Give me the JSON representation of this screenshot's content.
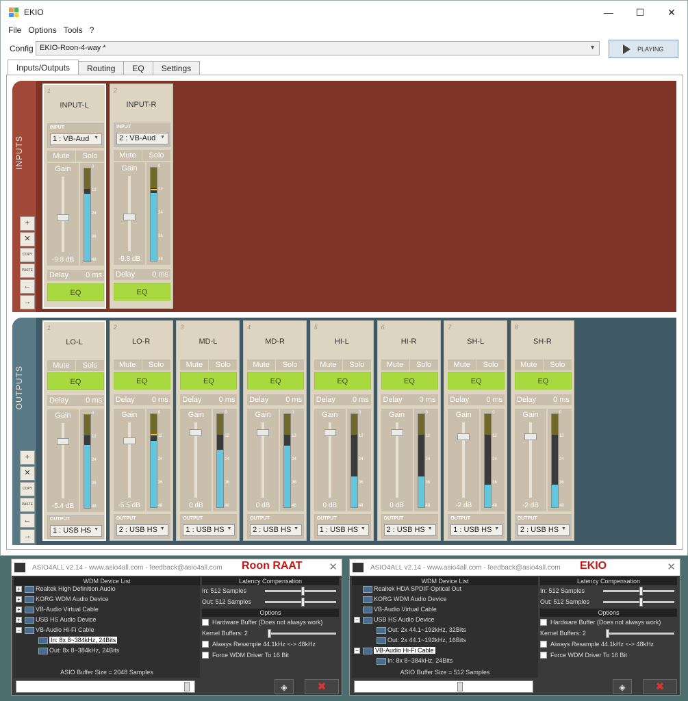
{
  "window": {
    "title": "EKIO",
    "min": "—",
    "max": "☐",
    "close": "✕"
  },
  "menu": [
    "File",
    "Options",
    "Tools",
    "?"
  ],
  "config": {
    "label": "Config",
    "value": "EKIO-Roon-4-way *",
    "play_label": "PLAYING"
  },
  "tabs": [
    "Inputs/Outputs",
    "Routing",
    "EQ",
    "Settings"
  ],
  "inputs_label": "INPUTS",
  "outputs_label": "OUTPUTS",
  "side_buttons": [
    "+",
    "✕",
    "COPY",
    "PASTE",
    "←",
    "→"
  ],
  "common": {
    "mute": "Mute",
    "solo": "Solo",
    "eq": "EQ",
    "delay": "Delay",
    "gain": "Gain",
    "input_lbl": "INPUT",
    "output_lbl": "OUTPUT"
  },
  "scale": [
    "0",
    "12",
    "24",
    "36",
    "48"
  ],
  "inputs": [
    {
      "num": "1",
      "name": "INPUT-L",
      "device": "1 : VB-Aud",
      "delay": "0 ms",
      "gain": "-9.8 dB",
      "gain_level": 0.45,
      "meter": 0.73,
      "peak": null
    },
    {
      "num": "2",
      "name": "INPUT-R",
      "device": "2 : VB-Aud",
      "delay": "0 ms",
      "gain": "-9.8 dB",
      "gain_level": 0.45,
      "meter": 0.73,
      "peak": 0.76
    }
  ],
  "outputs": [
    {
      "num": "1",
      "name": "LO-L",
      "device": "1 : USB HS",
      "delay": "0 ms",
      "gain": "-5.4 dB",
      "gain_level": 0.78,
      "meter": 0.68,
      "peak": null
    },
    {
      "num": "2",
      "name": "LO-R",
      "device": "2 : USB HS",
      "delay": "0 ms",
      "gain": "-5.5 dB",
      "gain_level": 0.78,
      "meter": 0.71,
      "peak": 0.77
    },
    {
      "num": "3",
      "name": "MD-L",
      "device": "1 : USB HS",
      "delay": "0 ms",
      "gain": "0 dB",
      "gain_level": 0.9,
      "meter": 0.62,
      "peak": null
    },
    {
      "num": "4",
      "name": "MD-R",
      "device": "2 : USB HS",
      "delay": "0 ms",
      "gain": "0 dB",
      "gain_level": 0.9,
      "meter": 0.66,
      "peak": null
    },
    {
      "num": "5",
      "name": "HI-L",
      "device": "1 : USB HS",
      "delay": "0 ms",
      "gain": "0 dB",
      "gain_level": 0.9,
      "meter": 0.33,
      "peak": null
    },
    {
      "num": "6",
      "name": "HI-R",
      "device": "2 : USB HS",
      "delay": "0 ms",
      "gain": "0 dB",
      "gain_level": 0.9,
      "meter": 0.33,
      "peak": null
    },
    {
      "num": "7",
      "name": "SH-L",
      "device": "1 : USB HS",
      "delay": "0 ms",
      "gain": "-2 dB",
      "gain_level": 0.84,
      "meter": 0.24,
      "peak": null
    },
    {
      "num": "8",
      "name": "SH-R",
      "device": "2 : USB HS",
      "delay": "0 ms",
      "gain": "-2 dB",
      "gain_level": 0.84,
      "meter": 0.24,
      "peak": null
    }
  ],
  "asio": [
    {
      "header": "ASIO4ALL v2.14 - www.asio4all.com - feedback@asio4all.com",
      "tag": "Roon RAAT",
      "close": "✕",
      "device_list_title": "WDM Device List",
      "devices": [
        {
          "pm": "+",
          "name": "Realtek High Definition Audio"
        },
        {
          "pm": "+",
          "name": "KORG WDM Audio Device"
        },
        {
          "pm": "+",
          "name": "VB-Audio Virtual Cable"
        },
        {
          "pm": "+",
          "name": "USB HS Audio Device"
        },
        {
          "pm": "−",
          "name": "VB-Audio Hi-Fi Cable"
        },
        {
          "pm": "",
          "name": "In:  8x 8~384kHz, 24Bits",
          "sub": true,
          "hl": true
        },
        {
          "pm": "",
          "name": "Out: 8x 8~384kHz, 24Bits",
          "sub": true
        }
      ],
      "latency_title": "Latency Compensation",
      "lat_in": "In:  512 Samples",
      "lat_out": "Out: 512 Samples",
      "in_level": 0.53,
      "out_level": 0.53,
      "options_title": "Options",
      "hw_buffer": "Hardware Buffer (Does not always work)",
      "kernel": "Kernel Buffers: 2",
      "resample": "Always Resample 44.1kHz <-> 48kHz",
      "force": "Force WDM Driver To 16 Bit",
      "buffer_label": "ASIO Buffer Size = 2048 Samples",
      "buffer_level": 0.98
    },
    {
      "header": "ASIO4ALL v2.14 - www.asio4all.com - feedback@asio4all.com",
      "tag": "EKIO",
      "close": "✕",
      "device_list_title": "WDM Device List",
      "devices": [
        {
          "pm": "",
          "name": "Realtek HDA SPDIF Optical Out"
        },
        {
          "pm": "",
          "name": "KORG WDM Audio Device"
        },
        {
          "pm": "",
          "name": "VB-Audio Virtual Cable"
        },
        {
          "pm": "−",
          "name": "USB HS Audio Device"
        },
        {
          "pm": "",
          "name": "Out: 2x 44.1~192kHz, 32Bits",
          "sub": true
        },
        {
          "pm": "",
          "name": "Out: 2x 44.1~192kHz, 16Bits",
          "sub": true
        },
        {
          "pm": "−",
          "name": "VB-Audio Hi-Fi Cable",
          "hl": true
        },
        {
          "pm": "",
          "name": "In:  8x 8~384kHz, 24Bits",
          "sub": true
        }
      ],
      "latency_title": "Latency Compensation",
      "lat_in": "In:  512 Samples",
      "lat_out": "Out: 512 Samples",
      "in_level": 0.53,
      "out_level": 0.53,
      "options_title": "Options",
      "hw_buffer": "Hardware Buffer (Does not always work)",
      "kernel": "Kernel Buffers: 2",
      "resample": "Always Resample 44.1kHz <-> 48kHz",
      "force": "Force WDM Driver To 16 Bit",
      "buffer_label": "ASIO Buffer Size = 512 Samples",
      "buffer_level": 0.6
    }
  ]
}
